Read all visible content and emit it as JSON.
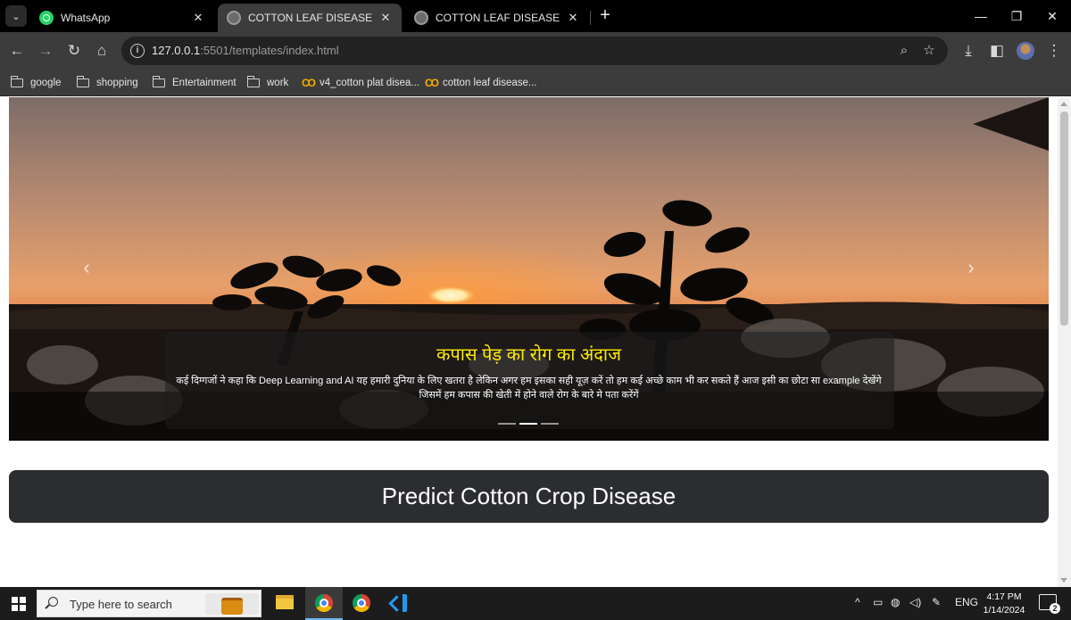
{
  "browser": {
    "tabs": [
      {
        "title": "WhatsApp",
        "favicon": "whatsapp-icon",
        "active": false
      },
      {
        "title": "COTTON LEAF DISEASE DETECT",
        "favicon": "globe-icon",
        "active": true
      },
      {
        "title": "COTTON LEAF DISEASE DETECT",
        "favicon": "globe-icon",
        "active": false
      }
    ],
    "new_tab_symbol": "+",
    "window_controls": {
      "minimize": "—",
      "restore": "❐",
      "close": "✕"
    },
    "url_host": "127.0.0.1",
    "url_rest": ":5501/templates/index.html",
    "bookmarks": [
      {
        "label": "google",
        "icon": "folder-icon"
      },
      {
        "label": "shopping",
        "icon": "folder-icon"
      },
      {
        "label": "Entertainment",
        "icon": "folder-icon"
      },
      {
        "label": "work",
        "icon": "folder-icon"
      },
      {
        "label": "v4_cotton plat disea...",
        "icon": "colab-icon"
      },
      {
        "label": "cotton leaf disease...",
        "icon": "colab-icon"
      }
    ]
  },
  "page": {
    "carousel": {
      "caption_title": "कपास पेड़ का रोग का अंदाज",
      "caption_line1": "कई दिग्गजों ने कहा कि Deep Learning and AI यह हमारी दुनिया के लिए खतरा है लेकिन अगर हम इसका सही यूज़ करें तो हम कई अच्छे काम भी कर सकते हैं आज इसी का छोटा सा example देखेंगे",
      "caption_line2": "जिसमें हम कपास की खेती में होने वाले रोग के बारे मे पता करेंगें",
      "slide_count": 3,
      "active_slide": 2,
      "title_color": "#ffeb00"
    },
    "predict_heading": "Predict Cotton Crop Disease"
  },
  "taskbar": {
    "search_placeholder": "Type here to search",
    "language": "ENG",
    "time": "4:17 PM",
    "date": "1/14/2024",
    "notification_count": "2"
  }
}
